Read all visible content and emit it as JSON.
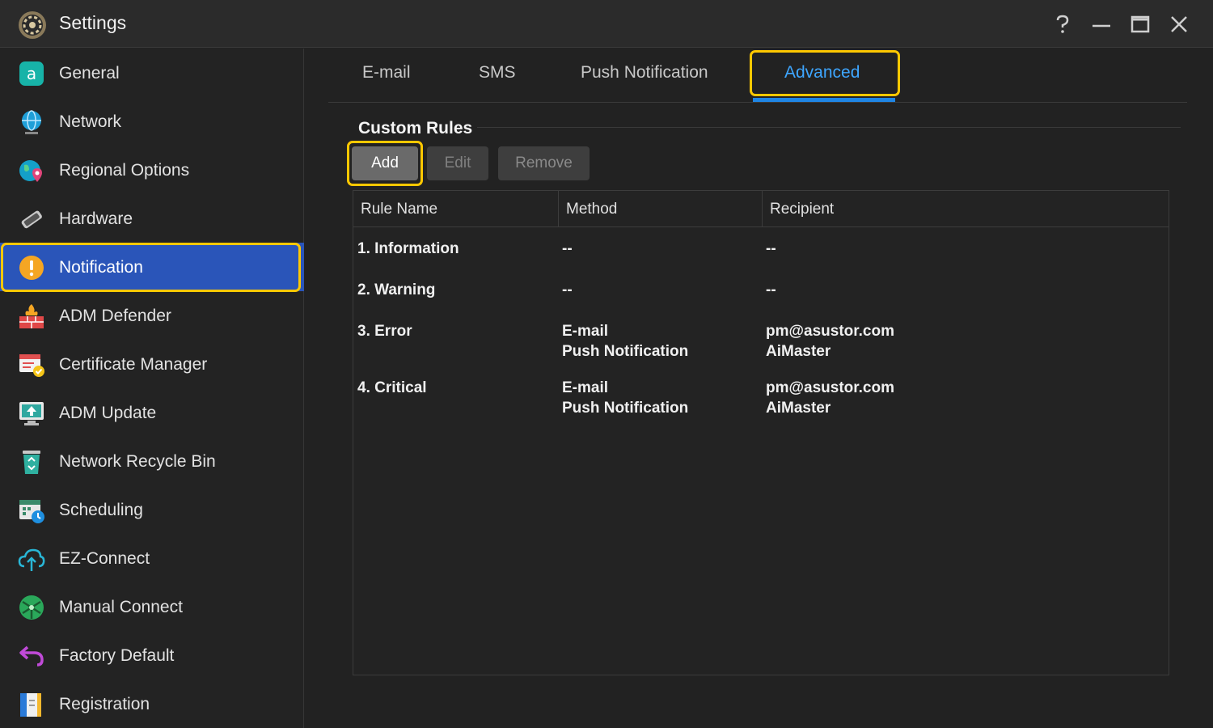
{
  "window": {
    "title": "Settings",
    "controls": [
      "help-icon",
      "minimize-icon",
      "maximize-icon",
      "close-icon"
    ]
  },
  "sidebar": {
    "items": [
      {
        "label": "General",
        "icon": "general-icon"
      },
      {
        "label": "Network",
        "icon": "globe-icon"
      },
      {
        "label": "Regional Options",
        "icon": "location-globe-icon"
      },
      {
        "label": "Hardware",
        "icon": "hardware-icon"
      },
      {
        "label": "Notification",
        "icon": "alert-icon",
        "active": true
      },
      {
        "label": "ADM Defender",
        "icon": "firewall-icon"
      },
      {
        "label": "Certificate Manager",
        "icon": "certificate-icon"
      },
      {
        "label": "ADM Update",
        "icon": "update-monitor-icon"
      },
      {
        "label": "Network Recycle Bin",
        "icon": "recycle-bin-icon"
      },
      {
        "label": "Scheduling",
        "icon": "calendar-clock-icon"
      },
      {
        "label": "EZ-Connect",
        "icon": "cloud-upload-icon"
      },
      {
        "label": "Manual Connect",
        "icon": "network-ball-icon"
      },
      {
        "label": "Factory Default",
        "icon": "undo-arrow-icon"
      },
      {
        "label": "Registration",
        "icon": "registration-icon"
      }
    ]
  },
  "tabs": [
    {
      "label": "E-mail"
    },
    {
      "label": "SMS"
    },
    {
      "label": "Push Notification"
    },
    {
      "label": "Advanced",
      "active": true
    }
  ],
  "section": {
    "title": "Custom Rules"
  },
  "toolbar": {
    "add_label": "Add",
    "edit_label": "Edit",
    "remove_label": "Remove"
  },
  "table": {
    "columns": [
      "Rule Name",
      "Method",
      "Recipient"
    ],
    "rows": [
      {
        "name": "1. Information",
        "method": [
          "--"
        ],
        "recipient": [
          "--"
        ]
      },
      {
        "name": "2. Warning",
        "method": [
          "--"
        ],
        "recipient": [
          "--"
        ]
      },
      {
        "name": "3. Error",
        "method": [
          "E-mail",
          "Push Notification"
        ],
        "recipient": [
          "pm@asustor.com",
          "AiMaster"
        ]
      },
      {
        "name": "4. Critical",
        "method": [
          "E-mail",
          "Push Notification"
        ],
        "recipient": [
          "pm@asustor.com",
          "AiMaster"
        ]
      }
    ]
  },
  "colors": {
    "active_item_bg": "#2a55b9",
    "active_tab_text": "#3ea6ff",
    "highlight_border": "#ffc800",
    "background": "#222222"
  }
}
